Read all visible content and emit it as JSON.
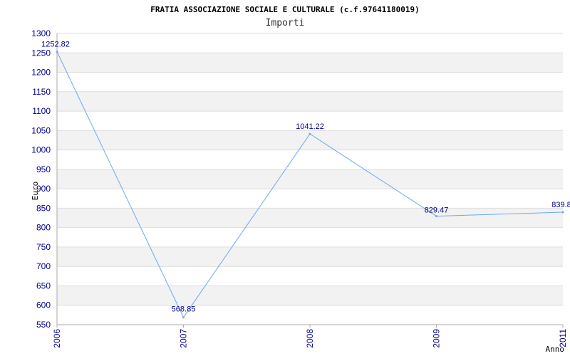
{
  "chart_data": {
    "type": "line",
    "title": "FRATIA ASSOCIAZIONE SOCIALE E CULTURALE (c.f.97641180019)",
    "subtitle": "Importi",
    "xlabel": "Anno",
    "ylabel": "Euro",
    "categories": [
      "2006",
      "2007",
      "2008",
      "2009",
      "2011"
    ],
    "values": [
      1252.82,
      568.85,
      1041.22,
      829.47,
      839.8
    ],
    "data_labels": [
      "1252.82",
      "568.85",
      "1041.22",
      "829.47",
      "839.8"
    ],
    "ylim": [
      550,
      1300
    ],
    "yticks": [
      "1300",
      "1250",
      "1200",
      "1150",
      "1100",
      "1050",
      "1000",
      "950",
      "900",
      "850",
      "800",
      "750",
      "700",
      "650",
      "600",
      "550"
    ],
    "grid": true,
    "colors": {
      "line": "#6aaaf0",
      "band": "#f2f2f2",
      "grid": "#dddddd",
      "axis": "#aaaaaa",
      "tick_text": "#00008b"
    }
  }
}
